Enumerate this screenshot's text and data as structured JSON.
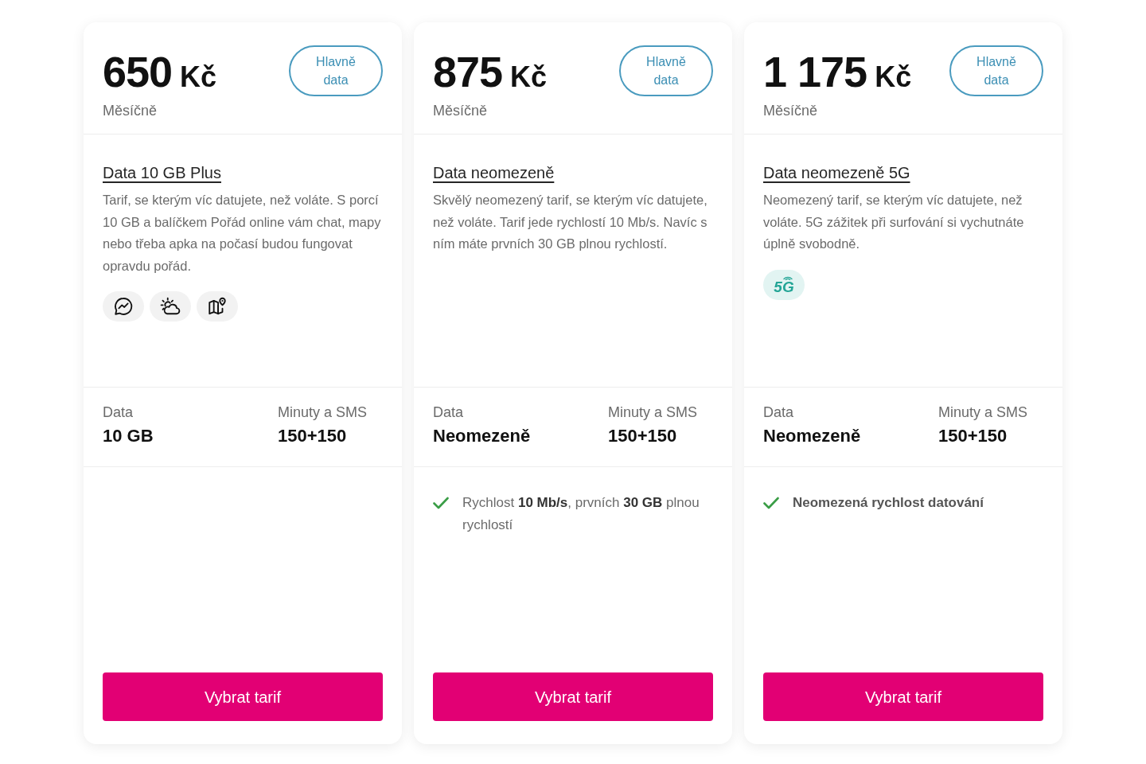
{
  "plans": [
    {
      "price": {
        "amount": "650",
        "currency": "Kč"
      },
      "period": "Měsíčně",
      "tag": "Hlavně data",
      "title": "Data 10 GB Plus",
      "description": "Tarif, se kterým víc datujete, než voláte. S porcí 10 GB a balíčkem Pořád online vám chat, mapy nebo třeba apka na počasí budou fungovat opravdu pořád.",
      "perks": [
        {
          "kind": "chat"
        },
        {
          "kind": "weather"
        },
        {
          "kind": "map"
        }
      ],
      "stats": [
        {
          "label": "Data",
          "value": "10 GB"
        },
        {
          "label": "Minuty a SMS",
          "value": "150+150"
        }
      ],
      "button": "Vybrat tarif"
    },
    {
      "price": {
        "amount": "875",
        "currency": "Kč"
      },
      "period": "Měsíčně",
      "tag": "Hlavně data",
      "title": "Data neomezeně",
      "description": "Skvělý neomezený tarif, se kterým víc datujete, než voláte. Tarif jede rychlostí 10 Mb/s. Navíc s ním máte prvních 30 GB plnou rychlostí.",
      "stats": [
        {
          "label": "Data",
          "value": "Neomezeně"
        },
        {
          "label": "Minuty a SMS",
          "value": "150+150"
        }
      ],
      "features": [
        {
          "text": "Rychlost **10 Mb/s**, prvních **30 GB** plnou rychlostí",
          "emphasized": false
        }
      ],
      "button": "Vybrat tarif"
    },
    {
      "price": {
        "amount": "1 175",
        "currency": "Kč"
      },
      "period": "Měsíčně",
      "tag": "Hlavně data",
      "title": "Data neomezeně 5G",
      "description": "Neomezený tarif, se kterým víc datujete, než voláte. 5G zážitek při surfování si vychutnáte úplně svobodně.",
      "perks": [
        {
          "kind": "network",
          "label": "5G"
        }
      ],
      "stats": [
        {
          "label": "Data",
          "value": "Neomezeně"
        },
        {
          "label": "Minuty a SMS",
          "value": "150+150"
        }
      ],
      "features": [
        {
          "text": "Neomezená rychlost datování",
          "emphasized": true
        }
      ],
      "button": "Vybrat tarif"
    }
  ]
}
